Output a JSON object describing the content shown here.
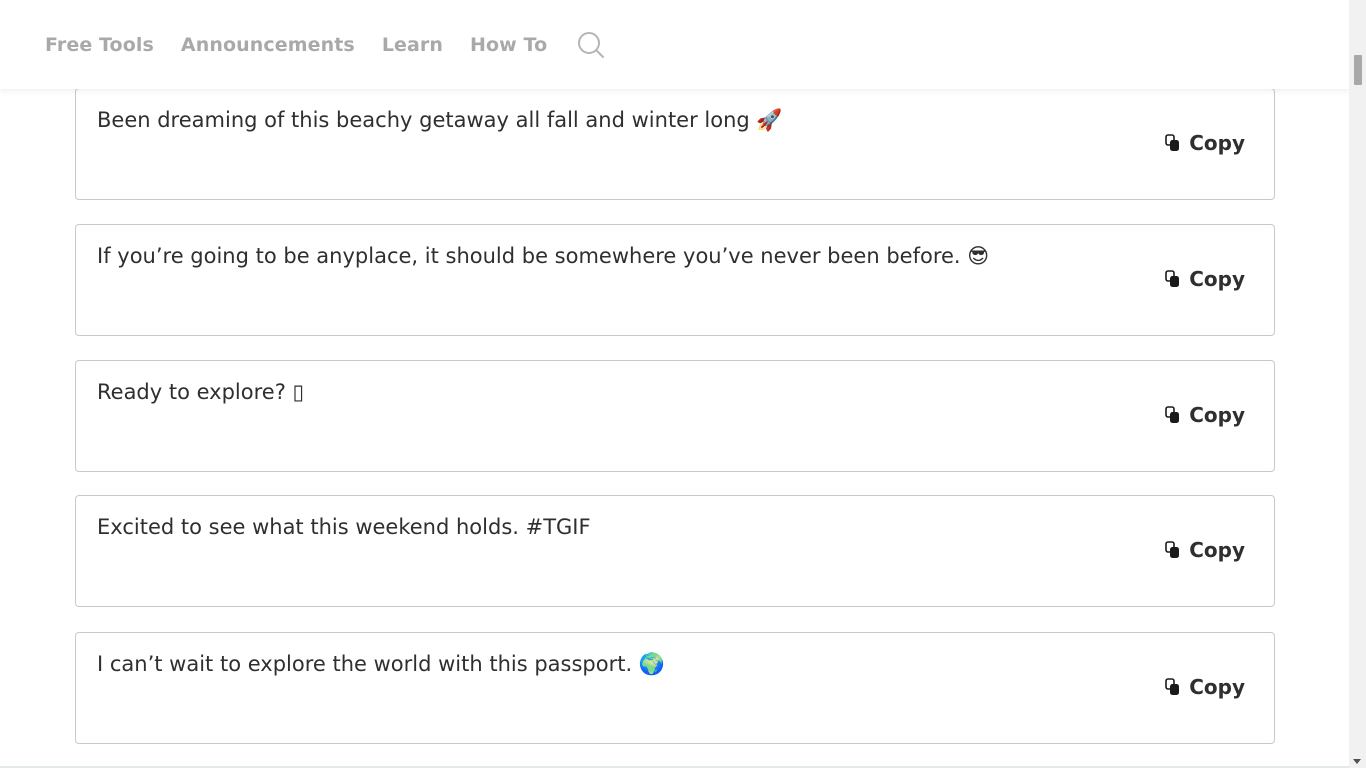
{
  "nav": {
    "links": [
      "Free Tools",
      "Announcements",
      "Learn",
      "How To"
    ],
    "search_icon": "search-icon"
  },
  "captions": [
    {
      "text": "Been dreaming of this beachy getaway all fall and winter long 🚀",
      "copy_label": "Copy"
    },
    {
      "text": "If you’re going to be anyplace, it should be somewhere you’ve never been before. 😎",
      "copy_label": "Copy"
    },
    {
      "text": "Ready to explore? ▯",
      "copy_label": "Copy"
    },
    {
      "text": "Excited to see what this weekend holds. #TGIF",
      "copy_label": "Copy"
    },
    {
      "text": "I can’t wait to explore the world with this passport. 🌍",
      "copy_label": "Copy"
    }
  ],
  "colors": {
    "nav_text": "#a9a9a9",
    "card_border": "#c9c9c9",
    "body_text": "#2f2f2f"
  }
}
